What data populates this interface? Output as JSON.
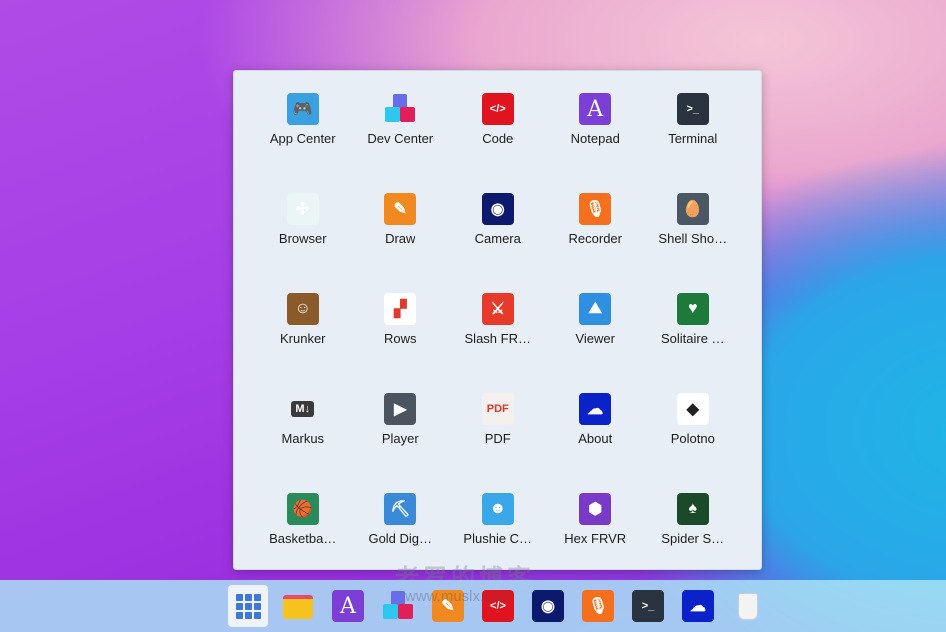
{
  "launcher": {
    "apps": [
      {
        "label": "App Center",
        "icon": "app-center-icon",
        "bg": "#3aa0e0",
        "glyph": "🎮"
      },
      {
        "label": "Dev Center",
        "icon": "dev-center-icon",
        "bg": "transparent",
        "glyph": ""
      },
      {
        "label": "Code",
        "icon": "code-icon",
        "bg": "#e0141e",
        "glyph": "</>"
      },
      {
        "label": "Notepad",
        "icon": "notepad-icon",
        "bg": "#7b3fd6",
        "glyph": "A"
      },
      {
        "label": "Terminal",
        "icon": "terminal-icon",
        "bg": "#2a3340",
        "glyph": ">_"
      },
      {
        "label": "Browser",
        "icon": "browser-icon",
        "bg": "#eaf6f6",
        "glyph": "✣"
      },
      {
        "label": "Draw",
        "icon": "draw-icon",
        "bg": "#f08a20",
        "glyph": "✎"
      },
      {
        "label": "Camera",
        "icon": "camera-icon",
        "bg": "#0c1a6e",
        "glyph": "◉"
      },
      {
        "label": "Recorder",
        "icon": "recorder-icon",
        "bg": "#f4701e",
        "glyph": "🎙"
      },
      {
        "label": "Shell Sho…",
        "icon": "shell-shockers-icon",
        "bg": "#4a5866",
        "glyph": "🥚"
      },
      {
        "label": "Krunker",
        "icon": "krunker-icon",
        "bg": "#8a5a2a",
        "glyph": "☺"
      },
      {
        "label": "Rows",
        "icon": "rows-icon",
        "bg": "#ffffff",
        "glyph": "▞"
      },
      {
        "label": "Slash FR…",
        "icon": "slash-frvr-icon",
        "bg": "#e63a2a",
        "glyph": "⚔"
      },
      {
        "label": "Viewer",
        "icon": "viewer-icon",
        "bg": "#2f8fe0",
        "glyph": "⛰"
      },
      {
        "label": "Solitaire …",
        "icon": "solitaire-icon",
        "bg": "#1e7a3a",
        "glyph": "♥"
      },
      {
        "label": "Markus",
        "icon": "markus-icon",
        "bg": "#3a3a3a",
        "glyph": "M↓"
      },
      {
        "label": "Player",
        "icon": "player-icon",
        "bg": "#4a5560",
        "glyph": "▶"
      },
      {
        "label": "PDF",
        "icon": "pdf-icon",
        "bg": "#f4f0ee",
        "glyph": "PDF"
      },
      {
        "label": "About",
        "icon": "about-icon",
        "bg": "#0a22c8",
        "glyph": "☁"
      },
      {
        "label": "Polotno",
        "icon": "polotno-icon",
        "bg": "#ffffff",
        "glyph": "◆"
      },
      {
        "label": "Basketba…",
        "icon": "basketball-icon",
        "bg": "#2a8a5a",
        "glyph": "🏀"
      },
      {
        "label": "Gold Dig…",
        "icon": "gold-digger-icon",
        "bg": "#3a8ad8",
        "glyph": "⛏"
      },
      {
        "label": "Plushie C…",
        "icon": "plushie-icon",
        "bg": "#3aa8e8",
        "glyph": "☻"
      },
      {
        "label": "Hex FRVR",
        "icon": "hex-frvr-icon",
        "bg": "#7a3ac8",
        "glyph": "⬢"
      },
      {
        "label": "Spider S…",
        "icon": "spider-solitaire-icon",
        "bg": "#1a4a2a",
        "glyph": "♠"
      }
    ]
  },
  "taskbar": {
    "items": [
      {
        "name": "files",
        "icon": "folder-icon",
        "bg": "#f6c21e",
        "glyph": ""
      },
      {
        "name": "notepad",
        "icon": "notepad-icon",
        "bg": "#7b3fd6",
        "glyph": "A"
      },
      {
        "name": "dev-center",
        "icon": "dev-center-icon",
        "bg": "transparent",
        "glyph": ""
      },
      {
        "name": "draw",
        "icon": "draw-icon",
        "bg": "#f08a20",
        "glyph": "✎"
      },
      {
        "name": "code",
        "icon": "code-icon",
        "bg": "#e0141e",
        "glyph": "</>"
      },
      {
        "name": "camera",
        "icon": "camera-icon",
        "bg": "#0c1a6e",
        "glyph": "◉"
      },
      {
        "name": "recorder",
        "icon": "recorder-icon",
        "bg": "#f4701e",
        "glyph": "🎙"
      },
      {
        "name": "terminal",
        "icon": "terminal-icon",
        "bg": "#2a3340",
        "glyph": ">_"
      },
      {
        "name": "about",
        "icon": "about-icon",
        "bg": "#0a22c8",
        "glyph": "☁"
      },
      {
        "name": "trash",
        "icon": "trash-icon",
        "bg": "transparent",
        "glyph": ""
      }
    ]
  },
  "watermark": {
    "text": "老罗的博客",
    "url": "www.muslx.com"
  }
}
